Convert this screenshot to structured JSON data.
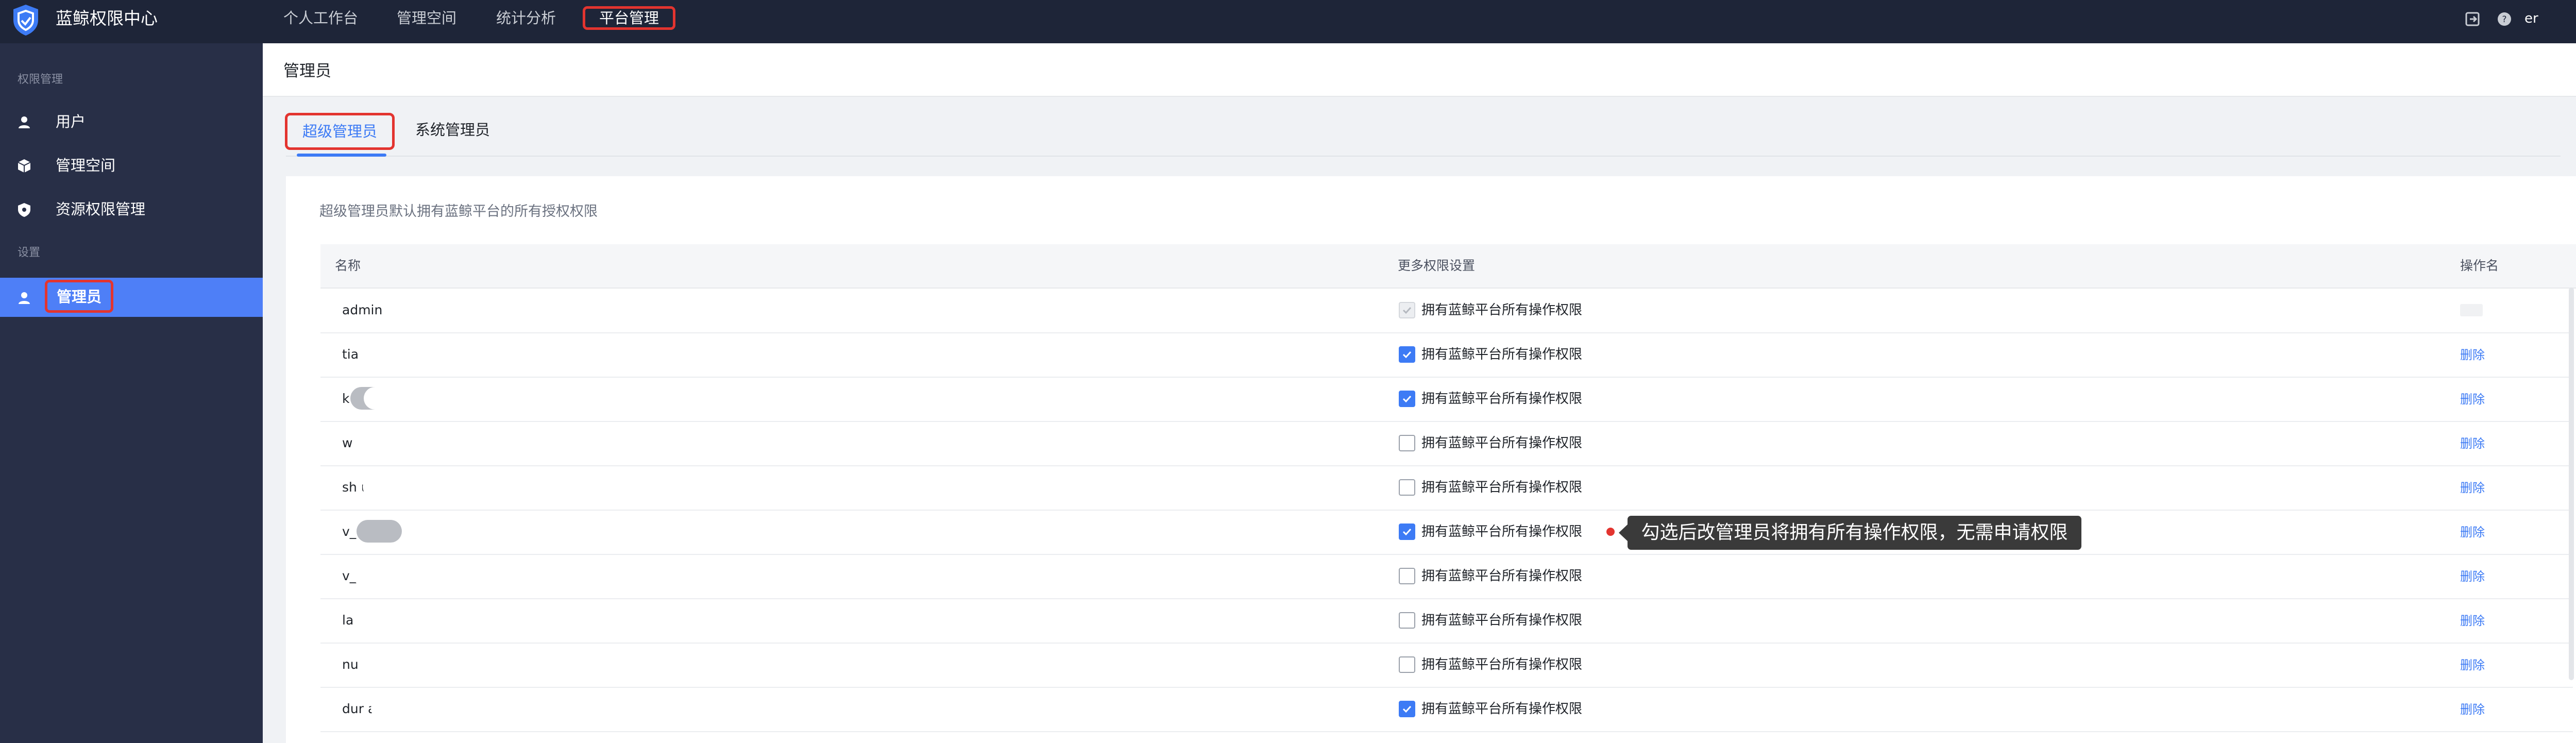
{
  "app": {
    "brand": "蓝鲸权限中心",
    "username": "er"
  },
  "topnav": {
    "items": [
      "个人工作台",
      "管理空间",
      "统计分析"
    ],
    "active": "平台管理"
  },
  "sidebar": {
    "section1": "权限管理",
    "items": [
      {
        "label": "用户",
        "icon": "user-icon"
      },
      {
        "label": "管理空间",
        "icon": "cube-icon"
      },
      {
        "label": "资源权限管理",
        "icon": "shield-icon"
      }
    ],
    "section2": "设置",
    "active_item": {
      "label": "管理员",
      "icon": "user-icon"
    }
  },
  "page": {
    "title": "管理员"
  },
  "tabs": {
    "super": "超级管理员",
    "system": "系统管理员"
  },
  "description": "超级管理员默认拥有蓝鲸平台的所有授权权限",
  "table": {
    "columns": [
      "名称",
      "更多权限设置",
      "操作名"
    ],
    "checkbox_label": "拥有蓝鲸平台所有操作权限",
    "delete_label": "删除",
    "rows": [
      {
        "name": "admin",
        "checked": true,
        "disabled": true
      },
      {
        "name": "tia    ru",
        "checked": true,
        "disabled": false
      },
      {
        "name": "k        vu",
        "checked": true,
        "disabled": false
      },
      {
        "name": "w      iu",
        "checked": false,
        "disabled": false
      },
      {
        "name": "sh      u",
        "checked": false,
        "disabled": false
      },
      {
        "name": "v_       g",
        "checked": true,
        "disabled": false
      },
      {
        "name": "v_     u",
        "checked": false,
        "disabled": false
      },
      {
        "name": "la        ng",
        "checked": false,
        "disabled": false
      },
      {
        "name": "nu       ang",
        "checked": false,
        "disabled": false
      },
      {
        "name": "dur      ang",
        "checked": true,
        "disabled": false
      }
    ]
  },
  "tooltip": "勾选后改管理员将拥有所有操作权限，无需申请权限",
  "colors": {
    "accent": "#3d7bf5",
    "highlight": "#e3342f",
    "topbar": "#1e2538",
    "sidebar": "#282f47"
  }
}
